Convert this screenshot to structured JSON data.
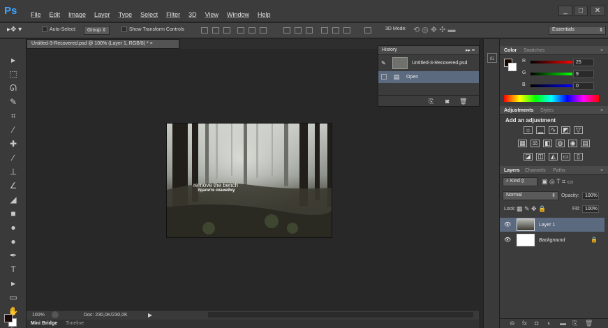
{
  "app": {
    "logo": "Ps",
    "menu": [
      "File",
      "Edit",
      "Image",
      "Layer",
      "Type",
      "Select",
      "Filter",
      "3D",
      "View",
      "Window",
      "Help"
    ],
    "window_buttons": [
      "_",
      "□",
      "✕"
    ]
  },
  "options_bar": {
    "auto_select_label": "Auto-Select:",
    "auto_select_value": "Group",
    "show_transform_label": "Show Transform Controls",
    "mode_3d_label": "3D Mode:",
    "workspace": "Essentials"
  },
  "document": {
    "tab_title": "Untitled-3-Recovered.psd @ 100% (Layer 1, RGB/8) * ×",
    "photo_text_en": "remove the bench",
    "photo_text_ru": "Удалите скамейку",
    "zoom": "100%",
    "doc_size": "Doc: 230,0K/230,0K"
  },
  "bottom_tabs": [
    "Mini Bridge",
    "Timeline"
  ],
  "history": {
    "title": "History",
    "snapshot": "Untitled-3-Recovered.psd",
    "step": "Open"
  },
  "color_panel": {
    "tabs": [
      "Color",
      "Swatches"
    ],
    "r": "25",
    "g": "9",
    "b": "0",
    "foreground": "#190900"
  },
  "adjustments": {
    "tabs": [
      "Adjustments",
      "Styles"
    ],
    "heading": "Add an adjustment"
  },
  "layers_panel": {
    "tabs": [
      "Layers",
      "Channels",
      "Paths"
    ],
    "kind_label": "Kind",
    "blend_mode": "Normal",
    "opacity_label": "Opacity:",
    "opacity": "100%",
    "lock_label": "Lock:",
    "fill_label": "Fill:",
    "fill": "100%",
    "layers": [
      {
        "name": "Layer 1",
        "selected": true
      },
      {
        "name": "Background",
        "selected": false
      }
    ]
  },
  "colors": {
    "accent_blue": "#3ea4ff",
    "selected_row": "#5c6a80"
  }
}
